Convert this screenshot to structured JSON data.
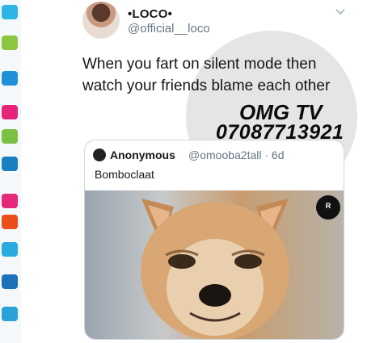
{
  "tweet": {
    "display_name": "•LOCO• ",
    "handle": "@official__loco",
    "text": "When you fart on silent mode then watch your friends blame each other",
    "menu_icon": "chevron-down-icon"
  },
  "watermark": {
    "line1": "OMG TV",
    "line2": "07087713921"
  },
  "quoted_tweet": {
    "display_name": "Anonymous",
    "handle": "@omooba2tall · 6d",
    "text": "Bomboclaat"
  },
  "image_logo": {
    "text": "R"
  }
}
